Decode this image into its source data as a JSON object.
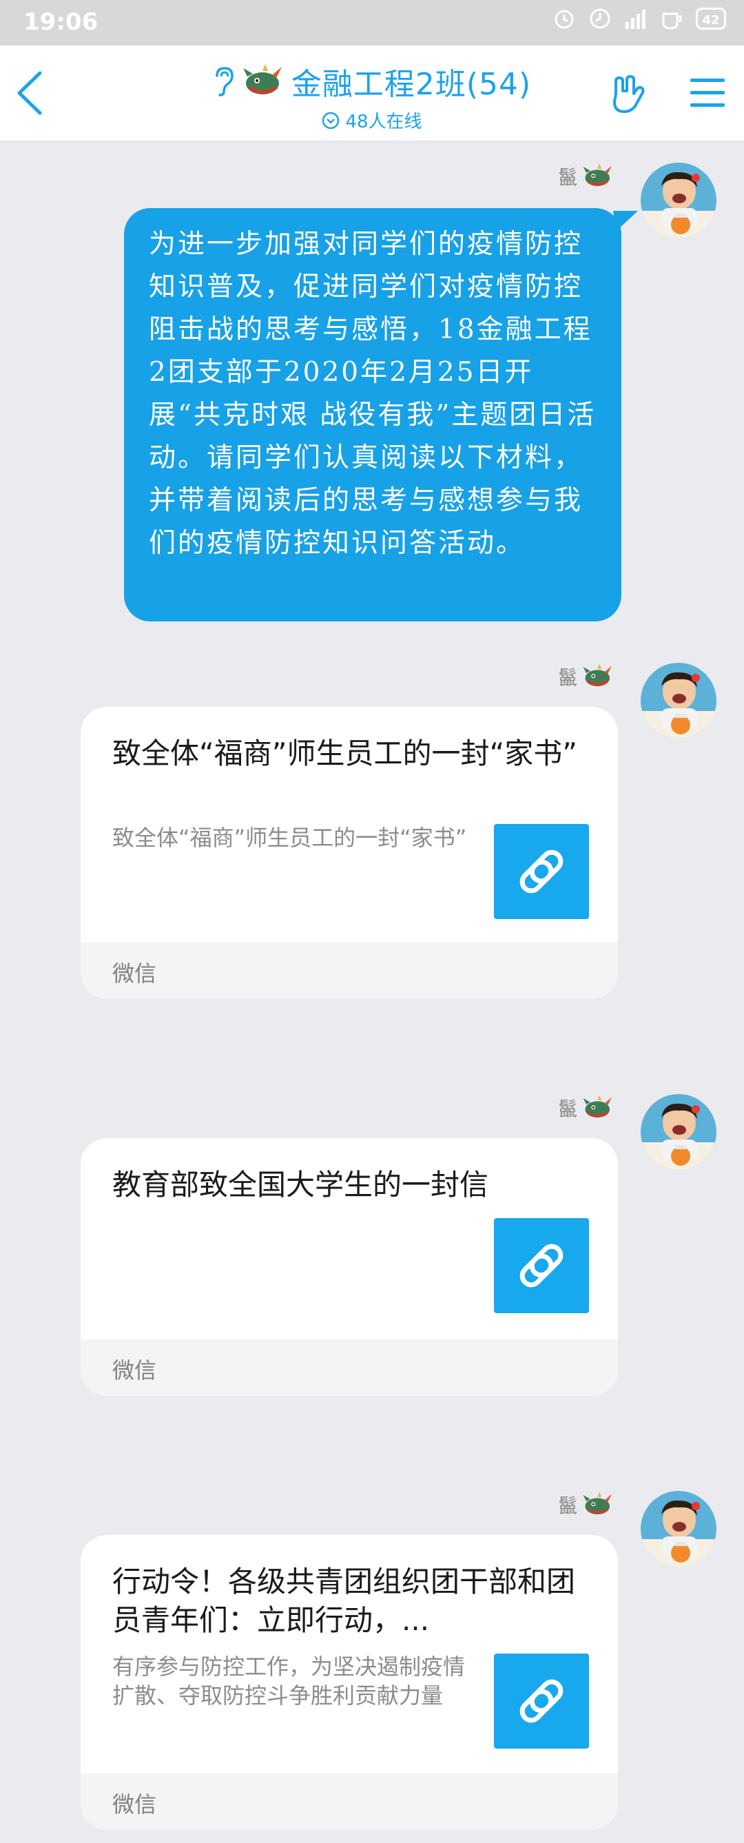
{
  "status_bar": {
    "time": "19:06",
    "battery": "42"
  },
  "header": {
    "title": "金融工程2班(54)",
    "online": "48人在线"
  },
  "messages": [
    {
      "sender": "鬣",
      "text": "为进一步加强对同学们的疫情防控知识普及，促进同学们对疫情防控阻击战的思考与感悟，18金融工程2团支部于2020年2月25日开展“共克时艰 战役有我”主题团日活动。请同学们认真阅读以下材料，并带着阅读后的思考与感想参与我们的疫情防控知识问答活动。"
    },
    {
      "sender": "鬣",
      "card": {
        "title": "致全体“福商”师生员工的一封“家书”",
        "desc": "致全体“福商”师生员工的一封“家书”",
        "source": "微信"
      }
    },
    {
      "sender": "鬣",
      "card": {
        "title": "教育部致全国大学生的一封信",
        "desc": "",
        "source": "微信"
      }
    },
    {
      "sender": "鬣",
      "card": {
        "title": "行动令！各级共青团组织团干部和团员青年们：立即行动，...",
        "desc": "有序参与防控工作，为坚决遏制疫情扩散、夺取防控斗争胜利贡献力量",
        "source": "微信"
      }
    }
  ],
  "colors": {
    "accent": "#17a1e6",
    "background": "#ebebef"
  }
}
